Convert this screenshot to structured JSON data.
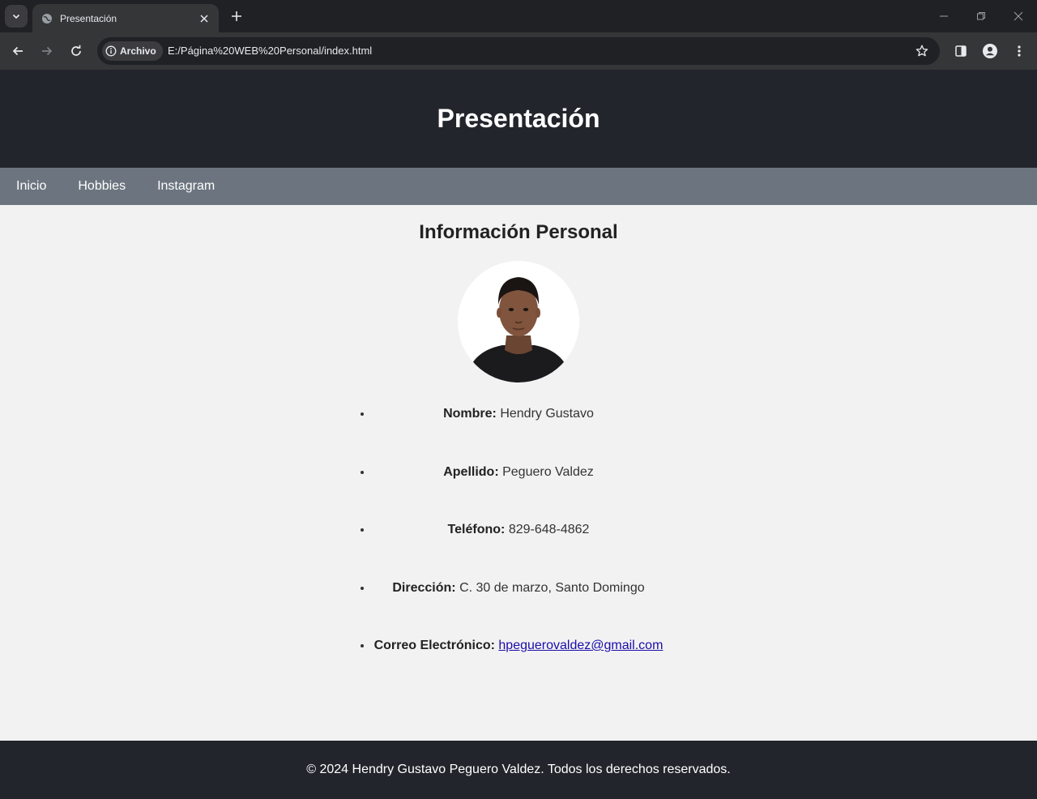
{
  "browser": {
    "tab_title": "Presentación",
    "site_chip": "Archivo",
    "url": "E:/Página%20WEB%20Personal/index.html"
  },
  "header": {
    "title": "Presentación"
  },
  "nav": {
    "items": [
      "Inicio",
      "Hobbies",
      "Instagram"
    ]
  },
  "main": {
    "section_title": "Información Personal",
    "info": [
      {
        "label": "Nombre:",
        "value": "Hendry Gustavo"
      },
      {
        "label": "Apellido:",
        "value": "Peguero Valdez"
      },
      {
        "label": "Teléfono:",
        "value": "829-648-4862"
      },
      {
        "label": "Dirección:",
        "value": "C. 30 de marzo, Santo Domingo"
      },
      {
        "label": "Correo Electrónico:",
        "value": "hpeguerovaldez@gmail.com"
      }
    ]
  },
  "footer": {
    "text": "© 2024 Hendry Gustavo Peguero Valdez. Todos los derechos reservados."
  },
  "colors": {
    "header_bg": "#22252b",
    "nav_bg": "#6c757f",
    "page_bg": "#f2f2f2",
    "link": "#1a0dab"
  }
}
